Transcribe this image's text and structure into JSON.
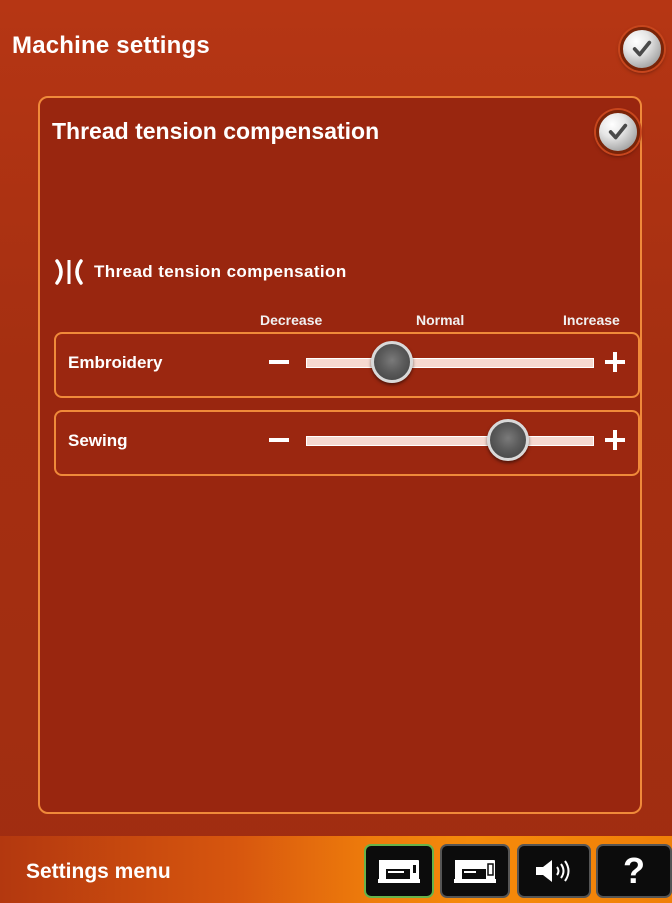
{
  "header": {
    "title": "Machine settings",
    "ok_icon": "checkmark-icon"
  },
  "panel": {
    "title": "Thread tension compensation",
    "section_icon": "thread-tension-icon",
    "section_label": "Thread tension compensation",
    "scale_labels": {
      "decrease": "Decrease",
      "normal": "Normal",
      "increase": "Increase"
    },
    "sliders": [
      {
        "label": "Embroidery",
        "value": 0.3,
        "min_label": "−",
        "max_label": "+"
      },
      {
        "label": "Sewing",
        "value": 0.7,
        "min_label": "−",
        "max_label": "+"
      }
    ]
  },
  "footer": {
    "title": "Settings menu",
    "buttons": [
      {
        "icon": "sewing-machine-icon",
        "active": true
      },
      {
        "icon": "sewing-machine-embroidery-icon",
        "active": false
      },
      {
        "icon": "sound-icon",
        "active": false
      },
      {
        "icon": "help-icon",
        "label": "?"
      }
    ]
  },
  "colors": {
    "background": "#a52f11",
    "border_accent": "#f08a3a",
    "footer_gradient_end": "#f58a0a",
    "active_button_border": "#67b34a"
  }
}
